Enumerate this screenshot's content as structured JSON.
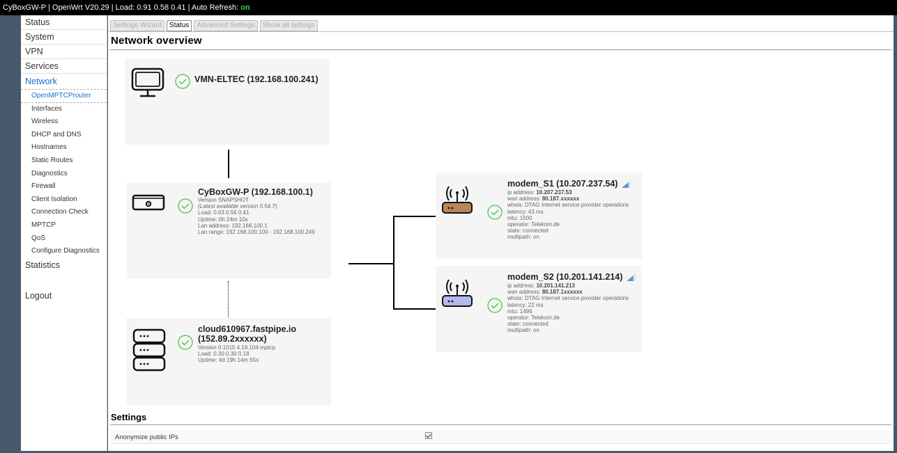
{
  "topbar": {
    "prefix": "CyBoxGW-P | OpenWrt V20.29 | Load: 0.91 0.58 0.41 | Auto Refresh: ",
    "refresh_state": "on"
  },
  "sidebar": {
    "items": [
      {
        "label": "Status"
      },
      {
        "label": "System"
      },
      {
        "label": "VPN"
      },
      {
        "label": "Services"
      },
      {
        "label": "Network"
      }
    ],
    "network_sub": [
      {
        "label": "OpenMPTCProuter"
      },
      {
        "label": "Interfaces"
      },
      {
        "label": "Wireless"
      },
      {
        "label": "DHCP and DNS"
      },
      {
        "label": "Hostnames"
      },
      {
        "label": "Static Routes"
      },
      {
        "label": "Diagnostics"
      },
      {
        "label": "Firewall"
      },
      {
        "label": "Client Isolation"
      },
      {
        "label": "Connection Check"
      },
      {
        "label": "MPTCP"
      },
      {
        "label": "QoS"
      },
      {
        "label": "Configure Diagnostics"
      }
    ],
    "statistics": "Statistics",
    "logout": "Logout"
  },
  "tabs": [
    {
      "label": "Settings Wizard"
    },
    {
      "label": "Status"
    },
    {
      "label": "Advanced Settings"
    },
    {
      "label": "Show all settings"
    }
  ],
  "page_title": "Network overview",
  "client": {
    "name": "VMN-ELTEC (192.168.100.241)",
    "icon": "monitor-icon"
  },
  "router": {
    "name": "CyBoxGW-P (192.168.100.1)",
    "version": "Version SNAPSHOT",
    "latest": "(Latest available version 0.54.7)",
    "load": "Load: 0.63 0.56 0.41",
    "uptime": "Uptime: 0h 24m 10s",
    "lan_address": "Lan address: 192.168.100.1",
    "lan_range": "Lan range: 192.168.100.100 - 192.168.100.249",
    "icon": "router-box-icon"
  },
  "server": {
    "name_line1": "cloud610967.fastpipe.io",
    "name_line2": "(152.89.2xxxxxx)",
    "version": "Version 0.1015 4.19.104-mptcp",
    "load": "Load: 0.30 0.30 0.18",
    "uptime": "Uptime: 4d 19h 14m 55s",
    "icon": "server-stack-icon"
  },
  "modems": [
    {
      "name": "modem_S1 (10.207.237.54)",
      "ip_label": "ip address: ",
      "ip": "10.207.237.53",
      "wan_label": "wan address: ",
      "wan": "80.187.xxxxxx",
      "whois": "whois: DTAG Internet service provider operations",
      "latency": "latency: 43 ms",
      "mtu": "mtu: 1500",
      "operator": "operator: Telekom.de",
      "state": "state: connected",
      "multipath": "multipath: on",
      "color": "#b8865a",
      "signal": 0.75
    },
    {
      "name": "modem_S2 (10.201.141.214)",
      "ip_label": "ip address: ",
      "ip": "10.201.141.213",
      "wan_label": "wan address: ",
      "wan": "80.187.1xxxxxx",
      "whois": "whois: DTAG Internet service provider operations",
      "latency": "latency: 22 ms",
      "mtu": "mtu: 1496",
      "operator": "operator: Telekom.de",
      "state": "state: connected",
      "multipath": "multipath: on",
      "color": "#b3b8f0",
      "signal": 0.75
    }
  ],
  "settings": {
    "title": "Settings",
    "anonymize_label": "Anonymize public IPs",
    "anonymize_checked": true
  },
  "colors": {
    "status_ok": "#3ec43e",
    "active_link": "#1a6fc7",
    "signal": "#6b8fd8"
  }
}
